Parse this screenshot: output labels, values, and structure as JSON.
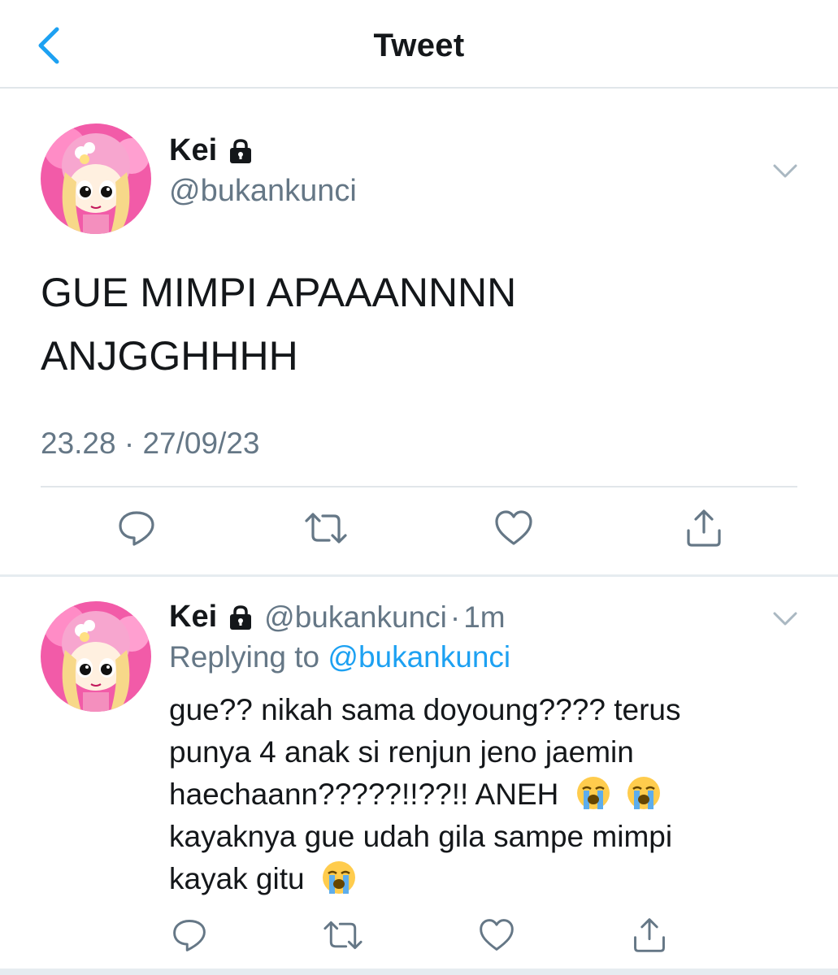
{
  "header": {
    "title": "Tweet",
    "back_icon": "chevron-left-icon",
    "accent_color": "#1da1f2"
  },
  "main_tweet": {
    "author": {
      "display_name": "Kei",
      "handle": "@bukankunci",
      "protected_icon": "lock-icon"
    },
    "text": "GUE MIMPI APAAANNNN\nANJGGHHHH",
    "timestamp": "23.28 · 27/09/23",
    "actions": [
      "reply-icon",
      "retweet-icon",
      "like-icon",
      "share-icon"
    ]
  },
  "reply_tweet": {
    "author": {
      "display_name": "Kei",
      "handle": "@bukankunci",
      "protected_icon": "lock-icon"
    },
    "separator": "·",
    "time": "1m",
    "replying_label": "Replying to",
    "replying_to": "@bukankunci",
    "lines": [
      "gue?? nikah sama doyoung???? terus",
      "punya 4 anak si renjun jeno jaemin",
      "haechaann?????!!??!! ANEH",
      "kayaknya gue udah gila sampe mimpi",
      "kayak gitu"
    ],
    "emoji": "loudly-crying-face",
    "actions": [
      "reply-icon",
      "retweet-icon",
      "like-icon",
      "share-icon"
    ]
  },
  "colors": {
    "text_primary": "#14171a",
    "text_secondary": "#657786",
    "link": "#1da1f2",
    "divider": "#e1e6ea",
    "avatar_pink": "#f25ba8"
  }
}
